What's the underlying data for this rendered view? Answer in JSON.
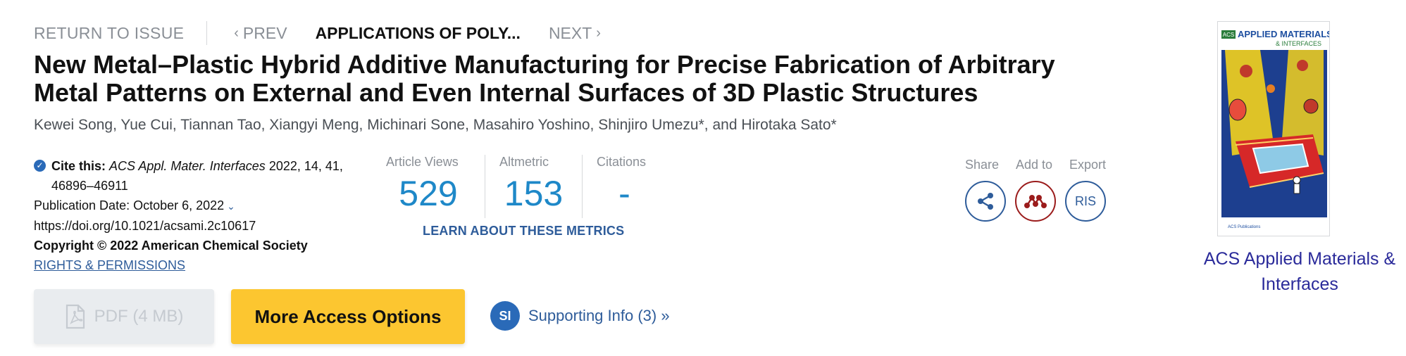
{
  "nav": {
    "return_label": "RETURN TO ISSUE",
    "prev_label": "PREV",
    "current_label": "APPLICATIONS OF POLY...",
    "next_label": "NEXT"
  },
  "article": {
    "title": "New Metal–Plastic Hybrid Additive Manufacturing for Precise Fabrication of Arbitrary Metal Patterns on External and Even Internal Surfaces of 3D Plastic Structures",
    "authors": "Kewei Song, Yue Cui, Tiannan Tao, Xiangyi Meng, Michinari Sone, Masahiro Yoshino, Shinjiro Umezu*, and Hirotaka Sato*"
  },
  "citation": {
    "cite_label": "Cite this:",
    "journal_abbrev": "ACS Appl. Mater. Interfaces",
    "details": "2022, 14, 41, 46896–46911",
    "publication_date": "Publication Date: October 6, 2022",
    "doi": "https://doi.org/10.1021/acsami.2c10617",
    "copyright": "Copyright © 2022 American Chemical Society",
    "rights_link": "RIGHTS & PERMISSIONS"
  },
  "metrics": {
    "items": [
      {
        "label": "Article Views",
        "value": "529"
      },
      {
        "label": "Altmetric",
        "value": "153"
      },
      {
        "label": "Citations",
        "value": "-"
      }
    ],
    "learn_link": "LEARN ABOUT THESE METRICS"
  },
  "actions": {
    "share_label": "Share",
    "add_label": "Add to",
    "export_label": "Export",
    "ris_label": "RIS"
  },
  "buttons": {
    "pdf_label": "PDF (4 MB)",
    "access_label": "More Access Options",
    "si_badge": "SI",
    "si_label": "Supporting Info (3) »"
  },
  "cover": {
    "badge": "ACS",
    "title_line1": "APPLIED MATERIALS",
    "title_line2": "& INTERFACES",
    "publisher": "ACS Publications"
  },
  "journal": {
    "name": "ACS Applied Materials & Interfaces"
  },
  "colors": {
    "link_blue": "#2e5c9a",
    "metric_blue": "#1e88c8",
    "access_yellow": "#fcc630",
    "mendeley_red": "#9b1c1c"
  }
}
